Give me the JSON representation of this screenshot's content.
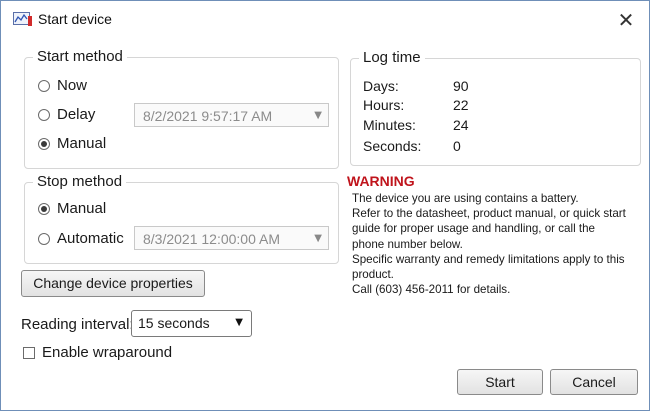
{
  "window": {
    "title": "Start device",
    "close_glyph": "✕"
  },
  "start_method": {
    "legend": "Start method",
    "options": [
      "Now",
      "Delay",
      "Manual"
    ],
    "selected": "Manual",
    "delay_datetime": "8/2/2021 9:57:17 AM"
  },
  "stop_method": {
    "legend": "Stop method",
    "options": [
      "Manual",
      "Automatic"
    ],
    "selected": "Manual",
    "automatic_datetime": "8/3/2021 12:00:00 AM"
  },
  "log_time": {
    "legend": "Log time",
    "rows": [
      {
        "label": "Days:",
        "value": "90"
      },
      {
        "label": "Hours:",
        "value": "22"
      },
      {
        "label": "Minutes:",
        "value": "24"
      },
      {
        "label": "Seconds:",
        "value": "0"
      }
    ]
  },
  "warning": {
    "title": "WARNING",
    "lines": [
      "The device you are using contains a battery.",
      "Refer to the datasheet, product manual, or quick start",
      "guide for proper usage and handling, or call the",
      "phone number below.",
      "Specific warranty and remedy limitations apply to this",
      "product.",
      "Call (603) 456-2011 for details."
    ],
    "color": "#c0141c"
  },
  "buttons": {
    "change_properties": "Change device properties",
    "start": "Start",
    "cancel": "Cancel"
  },
  "reading_interval": {
    "label": "Reading interval:",
    "value": "15 seconds"
  },
  "wraparound": {
    "label": "Enable wraparound",
    "checked": false
  },
  "icons": {
    "app": "chart-window-icon",
    "close": "close-icon",
    "dropdown": "chevron-down-icon"
  }
}
